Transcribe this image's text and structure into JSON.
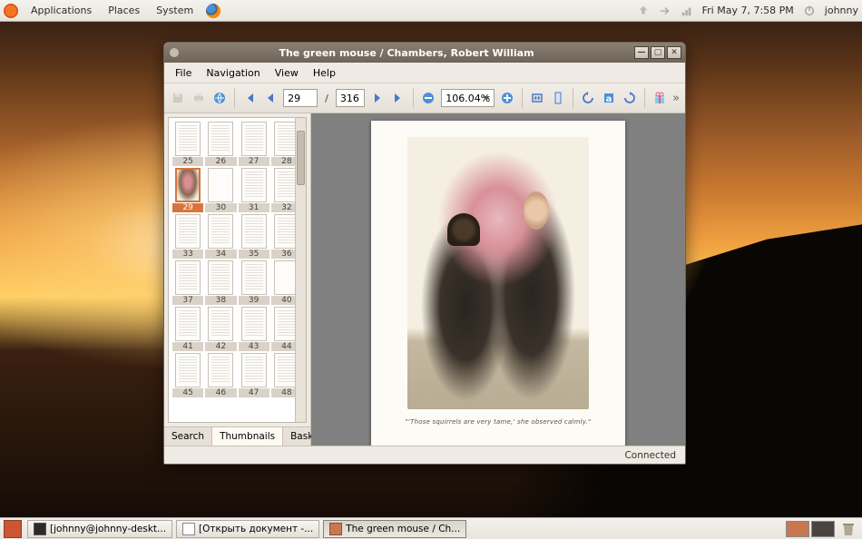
{
  "top_panel": {
    "menus": [
      "Applications",
      "Places",
      "System"
    ],
    "clock": "Fri May  7,  7:58 PM",
    "user": "johnny"
  },
  "bottom_panel": {
    "tasks": [
      {
        "label": "[johnny@johnny-deskt...",
        "icon": "terminal"
      },
      {
        "label": "[Открыть документ -...",
        "icon": "document"
      },
      {
        "label": "The green mouse / Ch...",
        "icon": "viewer",
        "active": true
      }
    ]
  },
  "window": {
    "title": "The green mouse / Chambers, Robert William",
    "menus": [
      "File",
      "Navigation",
      "View",
      "Help"
    ],
    "current_page": "29",
    "total_pages": "316",
    "zoom": "106.04%",
    "status": "Connected"
  },
  "sidebar": {
    "tabs": [
      "Search",
      "Thumbnails",
      "Basket"
    ],
    "active_tab": "Thumbnails",
    "selected": 29,
    "pages": [
      25,
      26,
      27,
      28,
      29,
      30,
      31,
      32,
      33,
      34,
      35,
      36,
      37,
      38,
      39,
      40,
      41,
      42,
      43,
      44,
      45,
      46,
      47,
      48
    ],
    "special": {
      "29": "illustration",
      "30": "sparse",
      "40": "sparse"
    }
  },
  "page_view": {
    "caption": "\"'Those squirrels are very tame,' she observed calmly.\""
  }
}
